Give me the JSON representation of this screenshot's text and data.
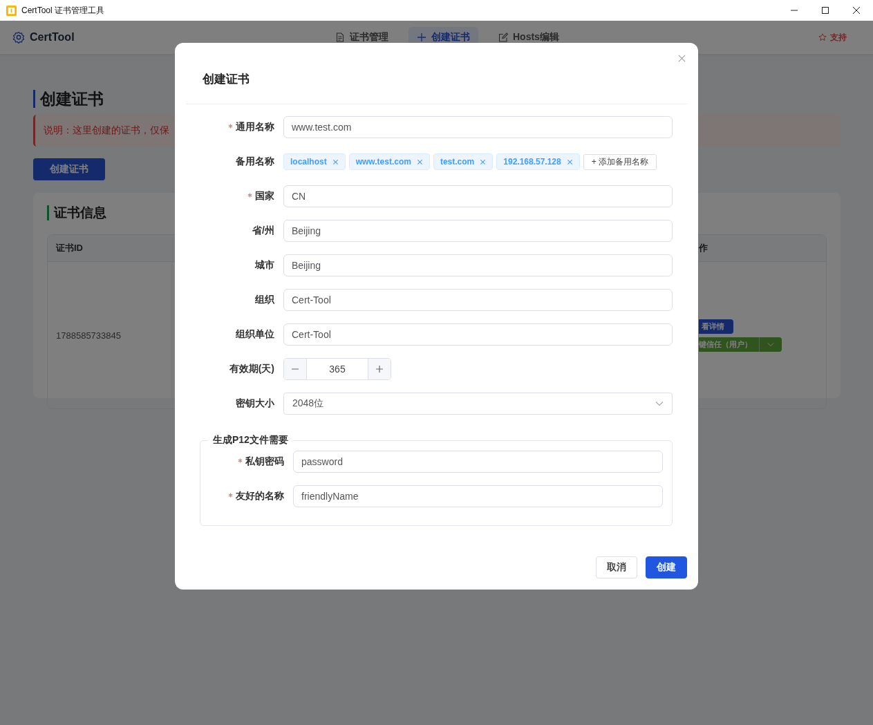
{
  "window": {
    "title": "CertTool 证书管理工具"
  },
  "header": {
    "brand": "CertTool",
    "tabs": [
      {
        "label": "证书管理",
        "selected": false
      },
      {
        "label": "创建证书",
        "selected": true
      },
      {
        "label": "Hosts编辑",
        "selected": false
      }
    ],
    "support": "支持"
  },
  "page": {
    "title": "创建证书",
    "notice": "说明：这里创建的证书，仅保",
    "create_button": "创建证书",
    "card_title": "证书信息",
    "table": {
      "columns": [
        "证书ID",
        "作"
      ],
      "rows": [
        {
          "id": "1788585733845",
          "actions": [
            "看详情",
            "键信任（用户）"
          ]
        }
      ]
    }
  },
  "dialog": {
    "title": "创建证书",
    "fields": [
      {
        "kind": "text",
        "label": "通用名称",
        "required": true,
        "value": "www.test.com"
      },
      {
        "kind": "tags",
        "label": "备用名称",
        "required": false,
        "tags": [
          "localhost",
          "www.test.com",
          "test.com",
          "192.168.57.128"
        ],
        "add_button": "+ 添加备用名称"
      },
      {
        "kind": "text",
        "label": "国家",
        "required": true,
        "value": "CN"
      },
      {
        "kind": "text",
        "label": "省/州",
        "required": false,
        "value": "Beijing"
      },
      {
        "kind": "text",
        "label": "城市",
        "required": false,
        "value": "Beijing"
      },
      {
        "kind": "text",
        "label": "组织",
        "required": false,
        "value": "Cert-Tool"
      },
      {
        "kind": "text",
        "label": "组织单位",
        "required": false,
        "value": "Cert-Tool"
      },
      {
        "kind": "number",
        "label": "有效期(天)",
        "required": false,
        "value": "365"
      },
      {
        "kind": "select",
        "label": "密钥大小",
        "required": false,
        "value": "2048位"
      }
    ],
    "fieldset": {
      "legend": "生成P12文件需要",
      "fields": [
        {
          "kind": "text",
          "label": "私钥密码",
          "required": true,
          "value": "password"
        },
        {
          "kind": "text",
          "label": "友好的名称",
          "required": true,
          "value": "friendlyName"
        }
      ]
    },
    "buttons": [
      {
        "label": "取消",
        "kind": "default"
      },
      {
        "label": "创建",
        "kind": "primary"
      }
    ]
  }
}
